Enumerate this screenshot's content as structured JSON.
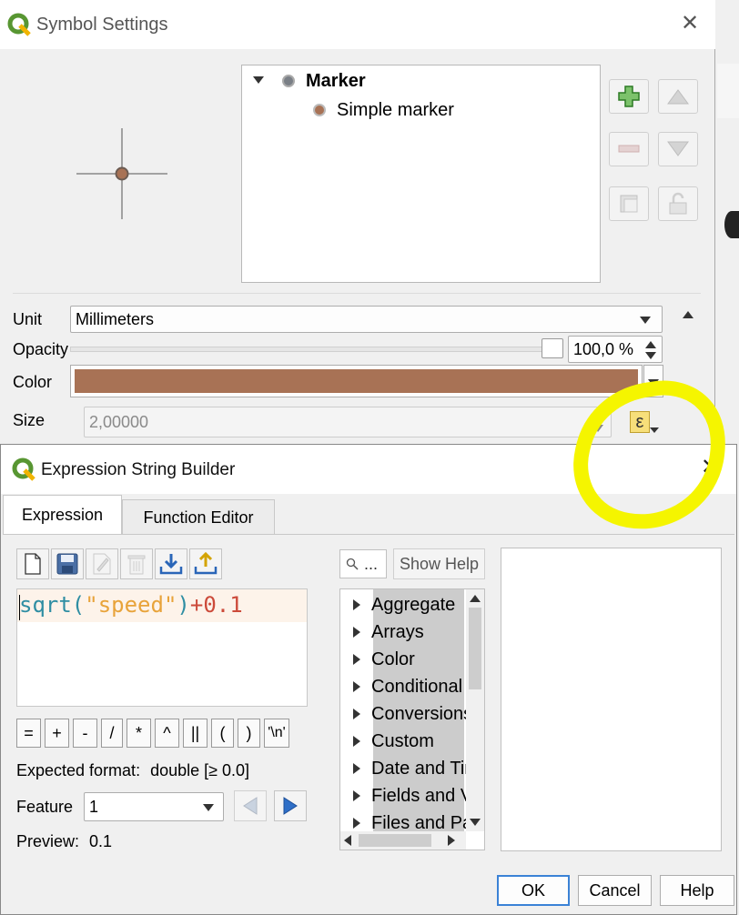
{
  "symbol_settings": {
    "title": "Symbol Settings",
    "layers": [
      {
        "label": "Marker",
        "bold": true
      },
      {
        "label": "Simple marker",
        "bold": false
      }
    ],
    "unit": {
      "label": "Unit",
      "value": "Millimeters"
    },
    "opacity": {
      "label": "Opacity",
      "value": "100,0 %",
      "fraction": 1.0
    },
    "color": {
      "label": "Color",
      "swatch": "#a87255"
    },
    "size": {
      "label": "Size",
      "value": "2,00000"
    },
    "expression_button_glyph": "ε"
  },
  "expression_builder": {
    "title": "Expression String Builder",
    "tabs": [
      {
        "label": "Expression",
        "active": true
      },
      {
        "label": "Function Editor",
        "active": false
      }
    ],
    "expression_text": {
      "func": "sqrt",
      "open": "(",
      "field": "\"speed\"",
      "close": ")",
      "op": "+",
      "num": "0.1"
    },
    "operators": [
      "=",
      "+",
      "-",
      "/",
      "*",
      "^",
      "||",
      "(",
      ")",
      "'\\n'"
    ],
    "search": {
      "placeholder": "..."
    },
    "show_help_label": "Show Help",
    "function_groups": [
      "Aggregate",
      "Arrays",
      "Color",
      "Conditional",
      "Conversions",
      "Custom",
      "Date and Time",
      "Fields and Values",
      "Files and Paths"
    ],
    "expected_format": {
      "label": "Expected format:",
      "value": "double [≥ 0.0]"
    },
    "feature": {
      "label": "Feature",
      "value": "1"
    },
    "preview": {
      "label": "Preview:",
      "value": "0.1"
    },
    "buttons": {
      "ok": "OK",
      "cancel": "Cancel",
      "help": "Help"
    }
  },
  "colors": {
    "highlight": "#f5f500",
    "expr_func": "#2f8ea3",
    "expr_string": "#e8a33a",
    "expr_number": "#cc4a3a",
    "marker_fill": "#a87255"
  }
}
